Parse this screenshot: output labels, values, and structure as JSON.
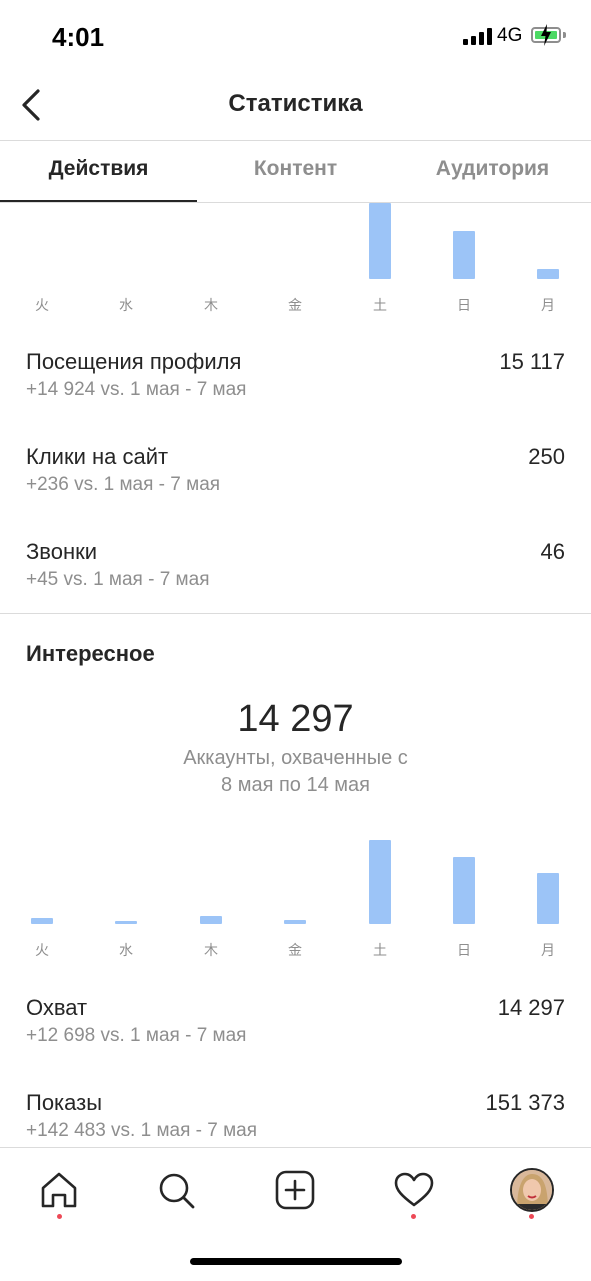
{
  "status_bar": {
    "time": "4:01",
    "network": "4G"
  },
  "header": {
    "title": "Статистика"
  },
  "tabs": [
    {
      "label": "Действия",
      "active": true
    },
    {
      "label": "Контент",
      "active": false
    },
    {
      "label": "Аудитория",
      "active": false
    }
  ],
  "days": [
    "火",
    "水",
    "木",
    "金",
    "土",
    "日",
    "月"
  ],
  "chart_data": [
    {
      "type": "bar",
      "categories": [
        "火",
        "水",
        "木",
        "金",
        "土",
        "日",
        "月"
      ],
      "values": [
        0,
        0,
        0,
        0,
        100,
        40,
        8
      ],
      "color": "#9cc4f7"
    },
    {
      "type": "bar",
      "categories": [
        "火",
        "水",
        "木",
        "金",
        "土",
        "日",
        "月"
      ],
      "values": [
        7,
        3,
        9,
        5,
        100,
        80,
        61
      ],
      "color": "#9cc4f7"
    }
  ],
  "metrics_top": [
    {
      "label": "Посещения профиля",
      "value": "15 117",
      "sub": "+14 924 vs. 1 мая - 7 мая"
    },
    {
      "label": "Клики на сайт",
      "value": "250",
      "sub": "+236 vs. 1 мая - 7 мая"
    },
    {
      "label": "Звонки",
      "value": "46",
      "sub": "+45 vs. 1 мая - 7 мая"
    }
  ],
  "interesting": {
    "title": "Интересное",
    "number": "14 297",
    "caption_line1": "Аккаунты, охваченные с",
    "caption_line2": "8 мая по 14 мая"
  },
  "metrics_bottom": [
    {
      "label": "Охват",
      "value": "14 297",
      "sub": "+12 698 vs. 1 мая - 7 мая"
    },
    {
      "label": "Показы",
      "value": "151 373",
      "sub": "+142 483 vs. 1 мая - 7 мая"
    }
  ],
  "tabbar": {
    "icons": [
      "home-icon",
      "search-icon",
      "new-post-icon",
      "heart-icon",
      "profile-avatar"
    ],
    "notification_color": "#ed4956"
  }
}
